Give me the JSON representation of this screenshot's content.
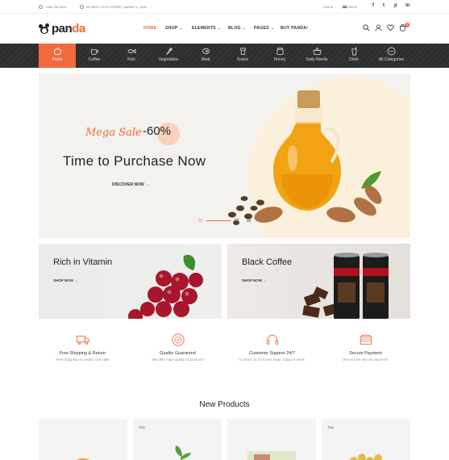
{
  "topbar": {
    "phone": "+456 786 0021",
    "address": "25 WEST 21TH STREET, MIAMI FL, USA",
    "currency": "USD",
    "language": "ENG"
  },
  "header": {
    "logo_main": "pan",
    "logo_accent": "da",
    "cart_count": "0",
    "nav": [
      {
        "label": "HOME"
      },
      {
        "label": "SHOP"
      },
      {
        "label": "ELEMENTS"
      },
      {
        "label": "BLOG"
      },
      {
        "label": "PAGES"
      },
      {
        "label": "BUY PANDA!"
      }
    ]
  },
  "categories": [
    {
      "label": "Fruits",
      "icon": "apple-icon"
    },
    {
      "label": "Coffee",
      "icon": "coffee-cup-icon"
    },
    {
      "label": "Fish",
      "icon": "fish-icon"
    },
    {
      "label": "Vegetables",
      "icon": "carrot-icon"
    },
    {
      "label": "Meat",
      "icon": "meat-icon"
    },
    {
      "label": "Snack",
      "icon": "snack-icon"
    },
    {
      "label": "Honey",
      "icon": "honey-jar-icon"
    },
    {
      "label": "Daily Needs",
      "icon": "basket-icon"
    },
    {
      "label": "Drink",
      "icon": "drink-icon"
    },
    {
      "label": "All Categories",
      "icon": "more-icon"
    }
  ],
  "hero": {
    "mega": "Mega Sale",
    "percent": "-60%",
    "title": "Time to Purchase Now",
    "cta": "DISCOVER NOW",
    "slides": [
      "01",
      "02",
      "03"
    ]
  },
  "promos": [
    {
      "title": "Rich in Vitamin",
      "link": "SHOP NOW"
    },
    {
      "title": "Black Coffee",
      "link": "SHOP NOW"
    }
  ],
  "features": [
    {
      "title": "Free Shipping & Return",
      "subtitle": "Free shipping on orders over $99",
      "icon": "truck-icon"
    },
    {
      "title": "Quality Guaranted",
      "subtitle": "We offer high quality of products",
      "icon": "quality-badge-icon"
    },
    {
      "title": "Customer Support 24/7",
      "subtitle": "Contact us 24 hours aday, 7days a week",
      "icon": "headset-icon"
    },
    {
      "title": "Secure Payment",
      "subtitle": "We ensure secure payment!",
      "icon": "wallet-icon"
    }
  ],
  "new_products": {
    "heading": "New Products",
    "badge_top": "Top"
  },
  "colors": {
    "accent": "#f26a3d",
    "dark_bar": "#2d2d2d",
    "badge_green": "#6ab04c"
  }
}
